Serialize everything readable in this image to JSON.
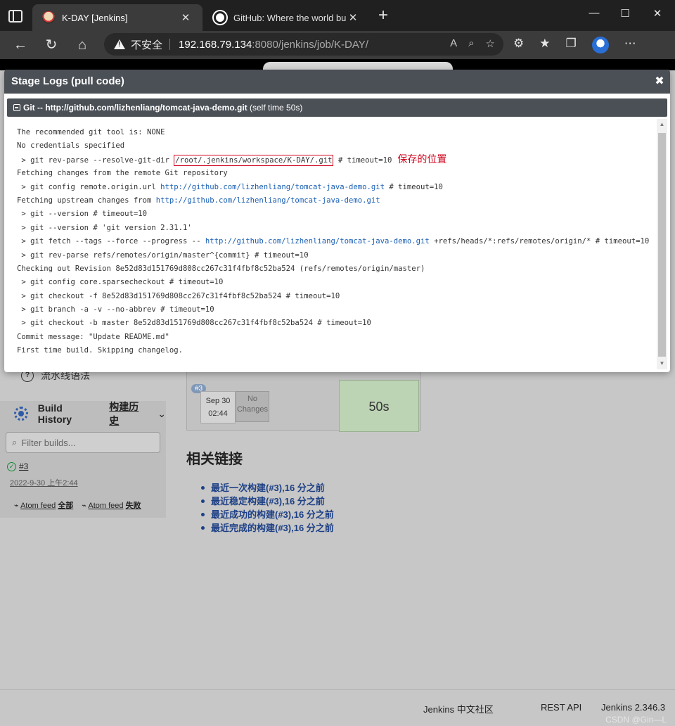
{
  "browser": {
    "tabs": [
      {
        "title": "K-DAY [Jenkins]",
        "icon": "jenkins-icon"
      },
      {
        "title": "GitHub: Where the world builds",
        "icon": "github-icon"
      }
    ],
    "address": {
      "insecure_label": "不安全",
      "host": "192.168.79.134",
      "rest": ":8080/jenkins/job/K-DAY/"
    }
  },
  "modal": {
    "title": "Stage Logs (pull code)",
    "close": "✖",
    "step_prefix": "Git -- ",
    "step_url": "http://github.com/lizhenliang/tomcat-java-demo.git",
    "step_suffix": " (self time 50s)",
    "annotation": "保存的位置",
    "log": [
      {
        "text": "The recommended git tool is: NONE"
      },
      {
        "text": "No credentials specified"
      },
      {
        "pre": " > git rev-parse --resolve-git-dir ",
        "boxed": "/root/.jenkins/workspace/K-DAY/.git",
        "post": " # timeout=10",
        "note": true
      },
      {
        "text": "Fetching changes from the remote Git repository"
      },
      {
        "pre": " > git config remote.origin.url ",
        "link": "http://github.com/lizhenliang/tomcat-java-demo.git",
        "post": " # timeout=10"
      },
      {
        "pre": "Fetching upstream changes from ",
        "link": "http://github.com/lizhenliang/tomcat-java-demo.git",
        "post": ""
      },
      {
        "text": " > git --version # timeout=10"
      },
      {
        "text": " > git --version # 'git version 2.31.1'"
      },
      {
        "pre": " > git fetch --tags --force --progress -- ",
        "link": "http://github.com/lizhenliang/tomcat-java-demo.git",
        "post": " +refs/heads/*:refs/remotes/origin/* # timeout=10"
      },
      {
        "text": " > git rev-parse refs/remotes/origin/master^{commit} # timeout=10"
      },
      {
        "text": "Checking out Revision 8e52d83d151769d808cc267c31f4fbf8c52ba524 (refs/remotes/origin/master)"
      },
      {
        "text": " > git config core.sparsecheckout # timeout=10"
      },
      {
        "text": " > git checkout -f 8e52d83d151769d808cc267c31f4fbf8c52ba524 # timeout=10"
      },
      {
        "text": " > git branch -a -v --no-abbrev # timeout=10"
      },
      {
        "text": " > git checkout -b master 8e52d83d151769d808cc267c31f4fbf8c52ba524 # timeout=10"
      },
      {
        "text": "Commit message: \"Update README.md\""
      },
      {
        "text": "First time build. Skipping changelog."
      }
    ]
  },
  "sidebar": {
    "pipeline_syntax": "流水线语法",
    "build_history_label": "Build History",
    "build_history_cn": "构建历史",
    "filter_placeholder": "Filter builds...",
    "build_number": "#3",
    "build_date": "2022-9-30 上午2:44",
    "atom_feed": "Atom feed",
    "feed_all": "全部",
    "feed_failed": "失败"
  },
  "stage_view": {
    "badge": "#3",
    "date": "Sep 30",
    "time": "02:44",
    "no_changes": "No Changes",
    "duration": "50s"
  },
  "related": {
    "title": "相关链接",
    "links": [
      "最近一次构建(#3),16 分之前",
      "最近稳定构建(#3),16 分之前",
      "最近成功的构建(#3),16 分之前",
      "最近完成的构建(#3),16 分之前"
    ]
  },
  "footer": {
    "community": "Jenkins 中文社区",
    "rest_api": "REST API",
    "version": "Jenkins 2.346.3"
  },
  "watermark": "CSDN @Gin—L"
}
